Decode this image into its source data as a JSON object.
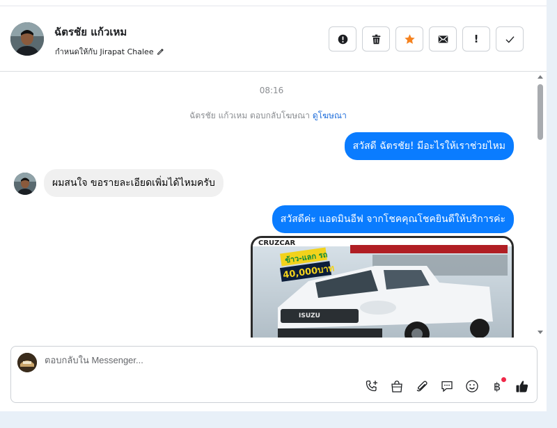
{
  "header": {
    "contact_name": "ฉัตรชัย แก้วเหม",
    "assigned_label": "กำหนดให้กับ Jirapat Chalee"
  },
  "actions": [
    {
      "name": "spam-button",
      "icon": "alert-circle-icon"
    },
    {
      "name": "delete-button",
      "icon": "trash-icon"
    },
    {
      "name": "star-button",
      "icon": "star-icon"
    },
    {
      "name": "unread-button",
      "icon": "envelope-icon"
    },
    {
      "name": "follow-up-button",
      "icon": "exclamation-icon"
    },
    {
      "name": "done-button",
      "icon": "checkmark-icon"
    }
  ],
  "conversation": {
    "timestamp": "08:16",
    "system_text": "ฉัตรชัย แก้วเหม ตอบกลับโฆษณา",
    "system_link": "ดูโฆษณา",
    "messages": [
      {
        "direction": "outgoing",
        "text": "สวัสดี ฉัตรชัย! มีอะไรให้เราช่วยไหม"
      },
      {
        "direction": "incoming",
        "text": "ผมสนใจ ขอรายละเอียดเพิ่มได้ไหมครับ"
      },
      {
        "direction": "outgoing",
        "text": "สวัสดีค่ะ แอดมินอีฟ จากโชคคุณโชคยินดีให้บริการค่ะ"
      }
    ],
    "image_card": {
      "brand": "ISUZU",
      "promo_line1": "ข้าว-แลก รถ",
      "promo_line2": "40,000บาท",
      "banner_text": "CRUZCAR"
    }
  },
  "composer": {
    "placeholder": "ตอบกลับใน Messenger...",
    "tools": [
      "phone-add-icon",
      "shopping-bag-icon",
      "paperclip-icon",
      "chat-bubble-icon",
      "emoji-icon",
      "baht-icon",
      "thumbs-up-icon"
    ],
    "baht_symbol": "฿"
  },
  "colors": {
    "accent": "#0a7cff",
    "star": "#f5821f",
    "notification": "#f02849"
  }
}
